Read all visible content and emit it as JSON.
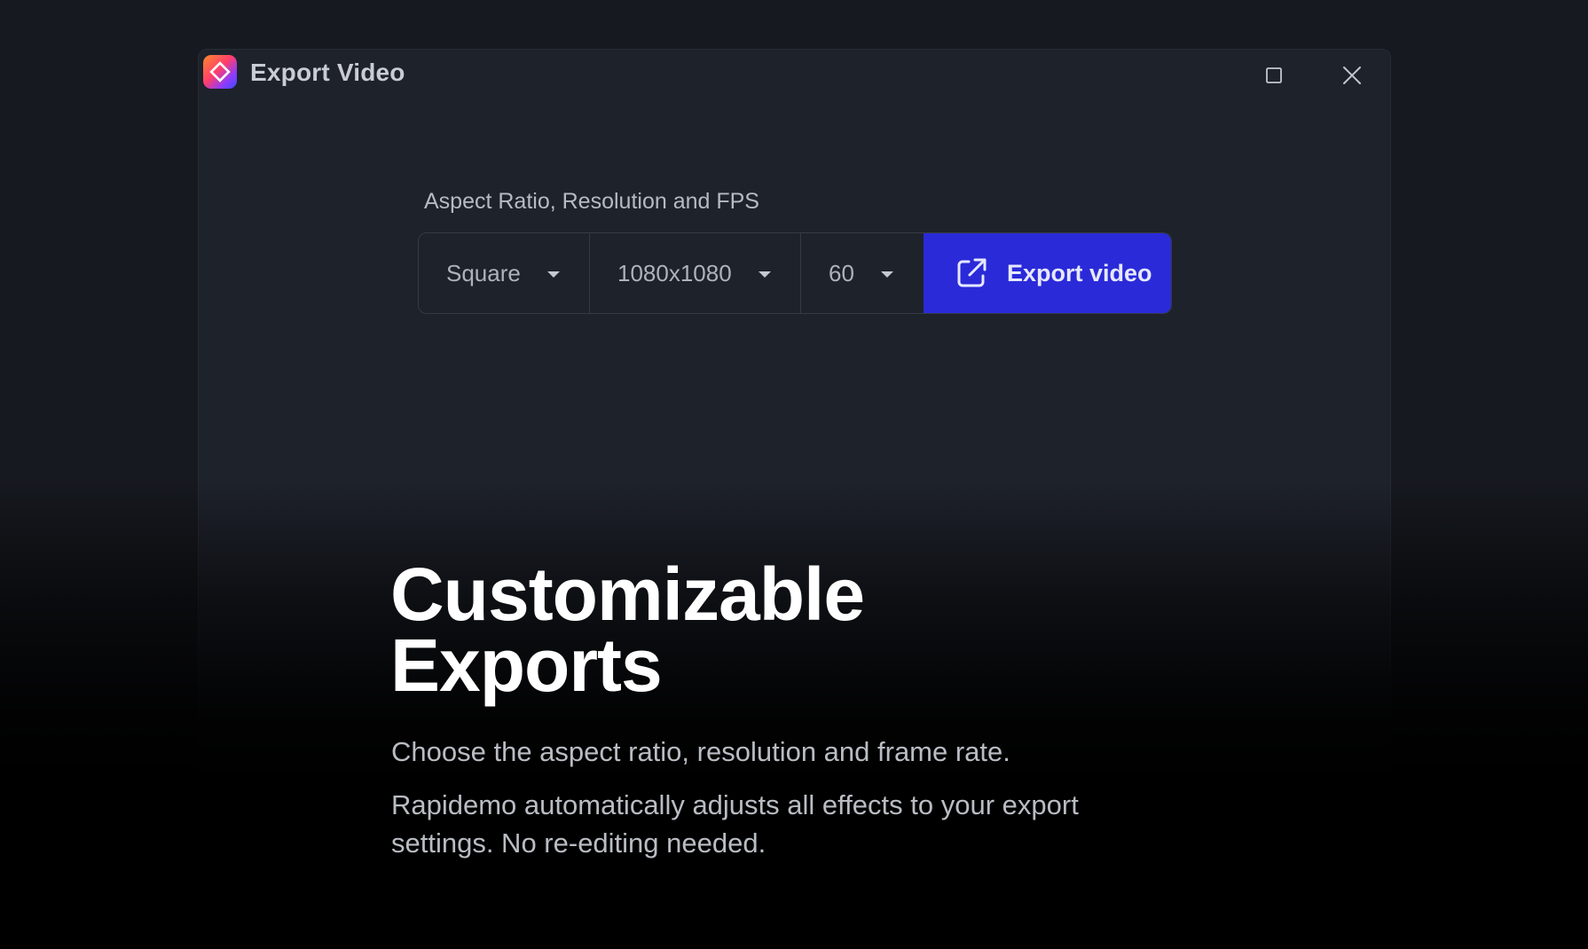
{
  "window": {
    "title": "Export Video",
    "logo_icon": "rapidemo-logo-icon",
    "controls": {
      "maximize_icon": "maximize-icon",
      "close_icon": "close-icon"
    }
  },
  "export_settings": {
    "label": "Aspect Ratio, Resolution and FPS",
    "aspect_ratio": {
      "selected": "Square",
      "icon": "chevron-down-icon"
    },
    "resolution": {
      "selected": "1080x1080",
      "icon": "chevron-down-icon"
    },
    "fps": {
      "selected": "60",
      "icon": "chevron-down-icon"
    },
    "export_button": {
      "label": "Export video",
      "icon": "external-link-icon",
      "color": "#2a2ad8"
    }
  },
  "hero": {
    "title_line1": "Customizable",
    "title_line2": "Exports",
    "description_1": "Choose the aspect ratio, resolution and frame rate.",
    "description_2": "Rapidemo automatically adjusts all effects to your export settings. No re-editing needed."
  },
  "colors": {
    "background": "#16191f",
    "window": "#1e222b",
    "accent": "#2a2ad8"
  }
}
